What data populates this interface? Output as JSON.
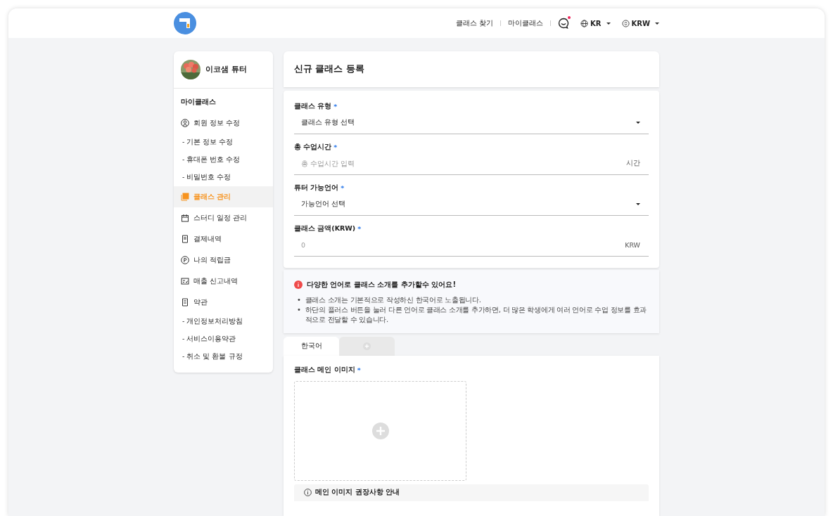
{
  "header": {
    "nav": [
      "클래스 찾기",
      "마이클래스"
    ],
    "chat_unread": true,
    "language": "KR",
    "currency": "KRW"
  },
  "profile": {
    "name": "이코샘 튜터"
  },
  "sidebar": {
    "items": [
      {
        "kind": "heading",
        "label": "마이클래스"
      },
      {
        "kind": "item",
        "label": "회원 정보 수정",
        "selected": false
      },
      {
        "kind": "sub",
        "label": "- 기본 정보 수정",
        "selected": false
      },
      {
        "kind": "sub",
        "label": "- 휴대폰 번호 수정",
        "selected": false
      },
      {
        "kind": "sub",
        "label": "- 비밀번호 수정",
        "selected": false
      },
      {
        "kind": "item",
        "label": "클래스 관리",
        "selected": true
      },
      {
        "kind": "item",
        "label": "스터디 일정 관리",
        "selected": false
      },
      {
        "kind": "item",
        "label": "결제내역",
        "selected": false
      },
      {
        "kind": "item",
        "label": "나의 적립금",
        "selected": false
      },
      {
        "kind": "item",
        "label": "매출 신고내역",
        "selected": false
      },
      {
        "kind": "item",
        "label": "약관",
        "selected": false
      },
      {
        "kind": "sub",
        "label": "- 개인정보처리방침",
        "selected": false
      },
      {
        "kind": "sub",
        "label": "- 서비스이용약관",
        "selected": false
      },
      {
        "kind": "sub",
        "label": "- 취소 및 환불 규정",
        "selected": false
      }
    ]
  },
  "page_title": "신규 클래스 등록",
  "fields": [
    {
      "kind": "select",
      "label": "클래스 유형",
      "required_mark": "*",
      "value": "클래스 유형 선택"
    },
    {
      "kind": "input",
      "label": "총 수업시간",
      "required_mark": "*",
      "placeholder": "총 수업시간 입력",
      "unit": "시간"
    },
    {
      "kind": "select",
      "label": "튜터 가능언어",
      "required_mark": "*",
      "value": "가능언어 선택"
    },
    {
      "kind": "input",
      "label": "클래스 금액(KRW)",
      "required_mark": "*",
      "placeholder": "0",
      "unit": "KRW"
    }
  ],
  "notice": {
    "title": "다양한 언어로 클래스 소개를 추가할수 있어요!",
    "lines": [
      {
        "bullet": "•",
        "text": "클래스 소개는 기본적으로 작성하신 한국어로 노출됩니다."
      },
      {
        "bullet": "•",
        "text": "하단의 플러스 버튼을 눌러 다른 언어로 클래스 소개를 추가하면, 더 많은 학생에게 여러 언어로 수업 정보를 효과적으로 전달할 수 있습니다."
      }
    ]
  },
  "tabs": [
    {
      "kind": "label",
      "label": "한국어",
      "selected": true
    },
    {
      "kind": "add",
      "selected": false
    }
  ],
  "image_upload": {
    "label": "클래스 메인 이미지",
    "required_mark": "*"
  },
  "guide": {
    "title": "메인 이미지 권장사항 안내"
  }
}
